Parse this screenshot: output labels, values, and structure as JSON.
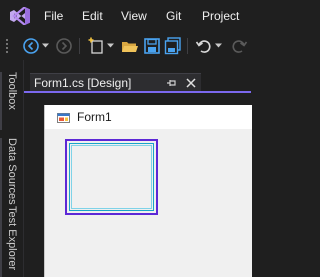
{
  "menubar": {
    "items": [
      "File",
      "Edit",
      "View",
      "Git",
      "Project"
    ]
  },
  "toolbar": {
    "icons": [
      "back-icon",
      "forward-icon",
      "new-project-icon",
      "open-folder-icon",
      "save-icon",
      "save-all-icon",
      "undo-icon",
      "redo-icon"
    ]
  },
  "sidebar": {
    "tabs": [
      "Toolbox",
      "Data Sources",
      "Test Explorer"
    ]
  },
  "document": {
    "tab_label": "Form1.cs [Design]"
  },
  "designer": {
    "form_title": "Form1"
  },
  "colors": {
    "background": "#1f1f1f",
    "accent": "#7b68ee",
    "selection": "#5d28d6",
    "control_border": "#19a4c9"
  }
}
